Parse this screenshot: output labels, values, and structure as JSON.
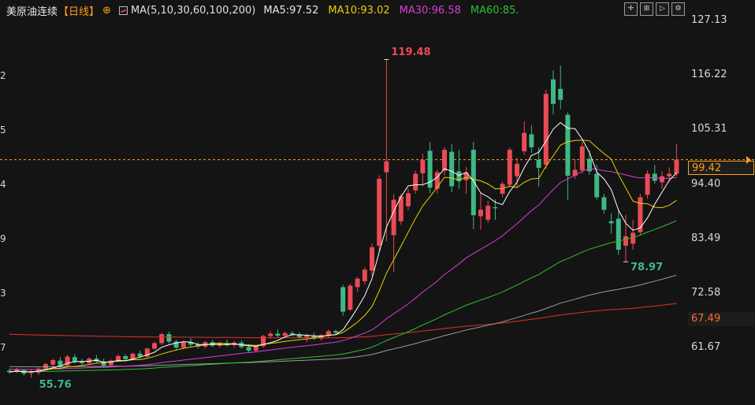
{
  "header": {
    "title": "美原油连续",
    "period": "【日线】",
    "add_icon": "circle-plus-icon",
    "ma_icon": "ma-indicator-icon",
    "ma_params": "MA(5,10,30,60,100,200)",
    "ma5": "MA5:97.52",
    "ma10": "MA10:93.02",
    "ma30": "MA30:96.58",
    "ma60": "MA60:85."
  },
  "toolbar": {
    "buttons": [
      {
        "name": "crosshair-icon",
        "glyph": "✛"
      },
      {
        "name": "zoom-in-icon",
        "glyph": "⊞"
      },
      {
        "name": "play-icon",
        "glyph": "▷"
      },
      {
        "name": "chart-settings-icon",
        "glyph": "⚙"
      }
    ]
  },
  "colors": {
    "up": "#ea4b55",
    "down": "#3fb886",
    "ma5": "#ffffff",
    "ma10": "#e6d200",
    "ma30": "#d43fd4",
    "ma60": "#2ec12e",
    "ma100": "#9a9a9a",
    "ma200": "#e03030",
    "last_price_line": "#ff9f1a"
  },
  "annotations": {
    "high": "119.48",
    "low_recent": "78.97",
    "low_start": "55.76"
  },
  "price_tag": "99.42",
  "ma100_tag": "67.49",
  "chart_data": {
    "type": "candlestick",
    "y_ticks": [
      "127.13",
      "116.22",
      "105.31",
      "94.40",
      "83.49",
      "72.58",
      "61.67"
    ],
    "ylim": [
      54.0,
      130.0
    ],
    "last_price": 99.42,
    "ma_label_value": 67.49,
    "high_point": 119.48,
    "low_points": [
      55.76,
      78.97
    ],
    "candles": [
      [
        57.2,
        57.6,
        56.6,
        56.9
      ],
      [
        57.0,
        57.8,
        56.7,
        57.4
      ],
      [
        57.3,
        57.4,
        56.2,
        56.6
      ],
      [
        56.7,
        57.5,
        55.76,
        56.9
      ],
      [
        56.8,
        57.8,
        56.3,
        57.6
      ],
      [
        57.6,
        58.8,
        57.3,
        58.5
      ],
      [
        58.4,
        59.6,
        58.0,
        59.3
      ],
      [
        59.2,
        59.9,
        57.5,
        58.1
      ],
      [
        58.2,
        60.4,
        58.0,
        60.0
      ],
      [
        59.9,
        60.5,
        58.6,
        59.0
      ],
      [
        59.1,
        59.6,
        58.3,
        58.7
      ],
      [
        58.7,
        59.9,
        58.4,
        59.6
      ],
      [
        59.6,
        60.3,
        58.8,
        59.0
      ],
      [
        59.0,
        59.6,
        57.9,
        58.2
      ],
      [
        58.3,
        59.4,
        58.0,
        59.2
      ],
      [
        59.2,
        60.5,
        58.9,
        60.1
      ],
      [
        60.1,
        60.5,
        59.2,
        59.5
      ],
      [
        59.5,
        60.8,
        59.2,
        60.6
      ],
      [
        60.6,
        61.2,
        59.6,
        60.0
      ],
      [
        60.0,
        61.8,
        59.8,
        61.6
      ],
      [
        61.6,
        63.0,
        61.3,
        62.7
      ],
      [
        62.7,
        64.8,
        62.3,
        64.5
      ],
      [
        64.5,
        65.0,
        62.6,
        63.0
      ],
      [
        63.0,
        63.4,
        61.3,
        61.8
      ],
      [
        61.8,
        63.2,
        61.5,
        62.9
      ],
      [
        62.9,
        63.7,
        62.0,
        62.4
      ],
      [
        62.4,
        62.9,
        61.6,
        62.0
      ],
      [
        62.0,
        63.1,
        61.6,
        62.9
      ],
      [
        62.9,
        63.3,
        61.9,
        62.2
      ],
      [
        62.2,
        63.0,
        61.8,
        62.6
      ],
      [
        62.6,
        63.4,
        62.0,
        62.3
      ],
      [
        62.3,
        63.1,
        61.8,
        62.8
      ],
      [
        62.8,
        63.3,
        61.6,
        61.9
      ],
      [
        61.9,
        62.5,
        60.9,
        61.2
      ],
      [
        61.2,
        62.3,
        60.8,
        62.1
      ],
      [
        62.1,
        64.4,
        61.8,
        64.1
      ],
      [
        64.1,
        65.1,
        63.6,
        64.6
      ],
      [
        64.6,
        65.4,
        63.9,
        64.2
      ],
      [
        64.2,
        65.0,
        63.8,
        64.7
      ],
      [
        64.7,
        65.1,
        64.1,
        64.4
      ],
      [
        64.4,
        64.9,
        63.6,
        63.9
      ],
      [
        63.9,
        64.6,
        62.9,
        64.2
      ],
      [
        64.2,
        64.8,
        63.3,
        63.6
      ],
      [
        63.6,
        64.5,
        63.2,
        64.3
      ],
      [
        64.3,
        65.4,
        63.8,
        65.1
      ],
      [
        65.1,
        65.4,
        64.3,
        64.8
      ],
      [
        73.9,
        74.4,
        68.2,
        69.0
      ],
      [
        69.4,
        74.6,
        69.1,
        74.2
      ],
      [
        73.9,
        76.0,
        73.0,
        75.6
      ],
      [
        75.1,
        77.9,
        74.4,
        77.4
      ],
      [
        77.2,
        82.6,
        76.1,
        81.9
      ],
      [
        82.2,
        96.3,
        81.1,
        95.6
      ],
      [
        96.9,
        119.48,
        83.1,
        99.1
      ],
      [
        84.3,
        92.5,
        76.9,
        91.4
      ],
      [
        87.1,
        92.6,
        86.4,
        92.1
      ],
      [
        90.1,
        93.6,
        89.4,
        92.7
      ],
      [
        93.3,
        97.2,
        92.6,
        96.6
      ],
      [
        96.7,
        100.6,
        94.1,
        99.4
      ],
      [
        101.2,
        103.0,
        92.7,
        93.8
      ],
      [
        93.6,
        97.4,
        92.7,
        96.9
      ],
      [
        97.2,
        101.9,
        96.3,
        101.4
      ],
      [
        101.0,
        102.6,
        92.9,
        94.1
      ],
      [
        97.1,
        101.4,
        93.6,
        95.1
      ],
      [
        95.3,
        98.0,
        92.6,
        96.9
      ],
      [
        101.4,
        103.0,
        85.5,
        88.3
      ],
      [
        88.1,
        92.9,
        85.4,
        89.4
      ],
      [
        87.4,
        91.2,
        86.8,
        90.2
      ],
      [
        89.9,
        91.5,
        87.4,
        89.7
      ],
      [
        92.6,
        95.0,
        91.9,
        94.6
      ],
      [
        94.4,
        101.9,
        93.9,
        101.4
      ],
      [
        96.1,
        99.8,
        93.8,
        98.6
      ],
      [
        101.1,
        107.1,
        100.4,
        104.8
      ],
      [
        104.5,
        106.3,
        100.8,
        101.9
      ],
      [
        99.4,
        101.9,
        94.1,
        97.8
      ],
      [
        98.4,
        113.4,
        97.6,
        112.6
      ],
      [
        115.5,
        117.3,
        108.5,
        110.6
      ],
      [
        113.6,
        118.3,
        109.5,
        111.4
      ],
      [
        108.4,
        108.9,
        91.4,
        96.2
      ],
      [
        96.2,
        99.5,
        95.6,
        97.4
      ],
      [
        97.3,
        103.0,
        96.6,
        102.1
      ],
      [
        99.6,
        101.2,
        96.4,
        97.1
      ],
      [
        96.6,
        98.4,
        91.4,
        91.9
      ],
      [
        91.9,
        92.6,
        88.6,
        89.4
      ],
      [
        87.1,
        88.7,
        84.6,
        86.7
      ],
      [
        87.6,
        89.2,
        80.4,
        81.4
      ],
      [
        82.2,
        88.4,
        78.97,
        84.1
      ],
      [
        82.6,
        87.4,
        81.4,
        84.8
      ],
      [
        84.9,
        92.6,
        84.4,
        91.9
      ],
      [
        92.4,
        97.3,
        91.6,
        96.6
      ],
      [
        96.6,
        98.4,
        94.6,
        95.2
      ],
      [
        94.9,
        97.1,
        93.6,
        96.1
      ],
      [
        96.1,
        97.9,
        94.9,
        96.6
      ],
      [
        96.6,
        102.6,
        96.1,
        99.42
      ]
    ]
  }
}
